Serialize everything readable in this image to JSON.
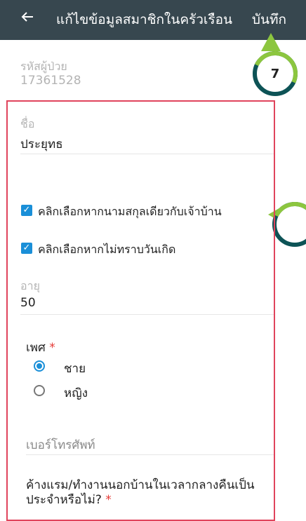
{
  "appbar": {
    "back_icon": "back-arrow-icon",
    "title": "แก้ไขข้อมูลสมาชิกในครัวเรือน",
    "save_label": "บันทึก"
  },
  "callouts": {
    "first_number": "7",
    "second_number": ""
  },
  "patient_id": {
    "label": "รหัสผู้ป่วย",
    "value": "17361528"
  },
  "name": {
    "label": "ชื่อ",
    "value": "ประยุทธ"
  },
  "checkboxes": [
    {
      "label": "คลิกเลือกหากนามสกุลเดียวกับเจ้าบ้าน",
      "checked": true
    },
    {
      "label": "คลิกเลือกหากไม่ทราบวันเกิด",
      "checked": true
    }
  ],
  "age": {
    "label": "อายุ",
    "value": "50"
  },
  "gender": {
    "label": "เพศ",
    "required_mark": "*",
    "options": [
      {
        "label": "ชาย",
        "selected": true
      },
      {
        "label": "หญิง",
        "selected": false
      }
    ]
  },
  "phone": {
    "label": "เบอร์โทรศัพท์"
  },
  "overnight": {
    "question": "ค้างแรม/ทำงานนอกบ้านในเวลากลางคืนเป็นประจำหรือไม่?",
    "required_mark": "*"
  },
  "colors": {
    "appbar": "#37474f",
    "accent": "#1a8fd8",
    "highlight": "#e0445c",
    "callout_ring": "#0d5356",
    "callout_accent": "#8cc63f"
  }
}
